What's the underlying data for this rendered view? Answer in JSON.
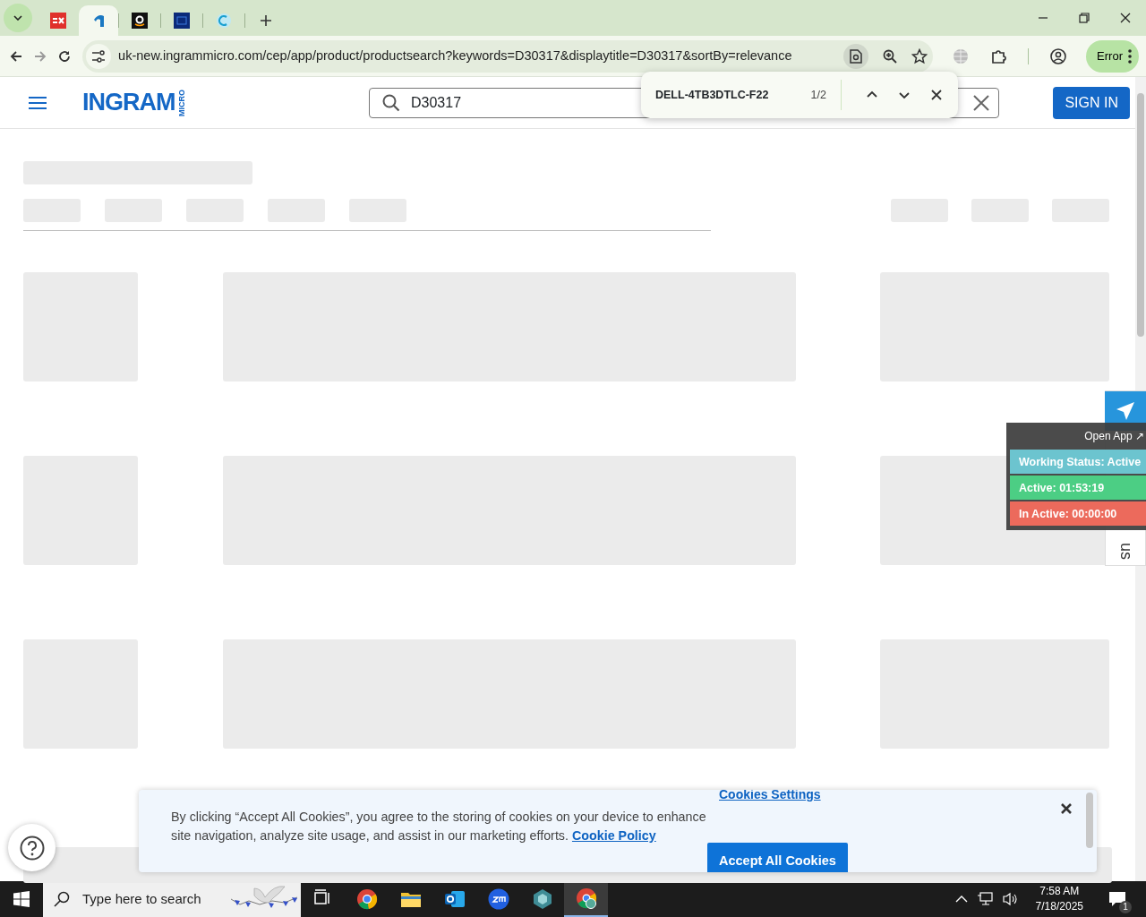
{
  "browser": {
    "tabs": [
      {
        "kind": "red",
        "selected": false
      },
      {
        "kind": "hook",
        "selected": true
      },
      {
        "kind": "black",
        "selected": false
      },
      {
        "kind": "navy",
        "selected": false
      },
      {
        "kind": "ring",
        "selected": false
      }
    ],
    "url": "uk-new.ingrammicro.com/cep/app/product/productsearch?keywords=D30317&displaytitle=D30317&sortBy=relevance",
    "profile_label": "Error"
  },
  "find_bar": {
    "query": "DELL-4TB3DTLC-F22",
    "count": "1/2"
  },
  "site_header": {
    "logo": "INGRAM",
    "logo_sub": "MICRO",
    "search_value": "D30317",
    "sign_in": "SIGN IN"
  },
  "feedback_tab": {
    "label": "us"
  },
  "status_widget": {
    "open_app": "Open App ↗",
    "rows": [
      {
        "label": "Working Status: Active",
        "color": "#6cc4cf"
      },
      {
        "label": "Active: 01:53:19",
        "color": "#4cce84"
      },
      {
        "label": "In Active: 00:00:00",
        "color": "#ec6a5c"
      }
    ]
  },
  "cookie_banner": {
    "settings_link": "Cookies Settings",
    "text": "By clicking “Accept All Cookies”, you agree to the storing of cookies on your device to enhance site navigation, analyze site usage, and assist in our marketing efforts.",
    "policy_link": "Cookie Policy",
    "accept_button": "Accept All Cookies"
  },
  "taskbar": {
    "search_placeholder": "Type here to search",
    "apps": [
      {
        "kind": "taskview",
        "selected": false
      },
      {
        "kind": "chrome",
        "selected": false
      },
      {
        "kind": "folder",
        "selected": false
      },
      {
        "kind": "outlook",
        "selected": false
      },
      {
        "kind": "zoom",
        "selected": false
      },
      {
        "kind": "gem",
        "selected": false
      },
      {
        "kind": "chrome-profile",
        "selected": true
      }
    ],
    "time": "7:58 AM",
    "date": "7/18/2025",
    "notifications": "1"
  }
}
